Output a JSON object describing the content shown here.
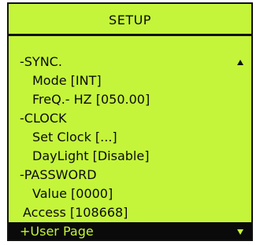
{
  "screen": {
    "title": "SETUP",
    "background_color": "#c4f53a",
    "text_color": "#0b0b0b"
  },
  "menu": {
    "items": [
      {
        "label": "-SYNC.",
        "indent": 0,
        "icon": "scroll-up-arrow-icon"
      },
      {
        "label": "Mode [INT]",
        "indent": 1
      },
      {
        "label": "FreQ.- HZ [050.00]",
        "indent": 1
      },
      {
        "label": "-CLOCK",
        "indent": 0
      },
      {
        "label": "Set Clock [...]",
        "indent": 1
      },
      {
        "label": "DayLight [Disable]",
        "indent": 1
      },
      {
        "label": "-PASSWORD",
        "indent": 0
      },
      {
        "label": "Value [0000]",
        "indent": 1
      },
      {
        "label": "Access [108668]",
        "indent": 0
      },
      {
        "label": "+User Page",
        "indent": 0,
        "selected": true,
        "icon": "scroll-down-arrow-icon"
      }
    ]
  }
}
